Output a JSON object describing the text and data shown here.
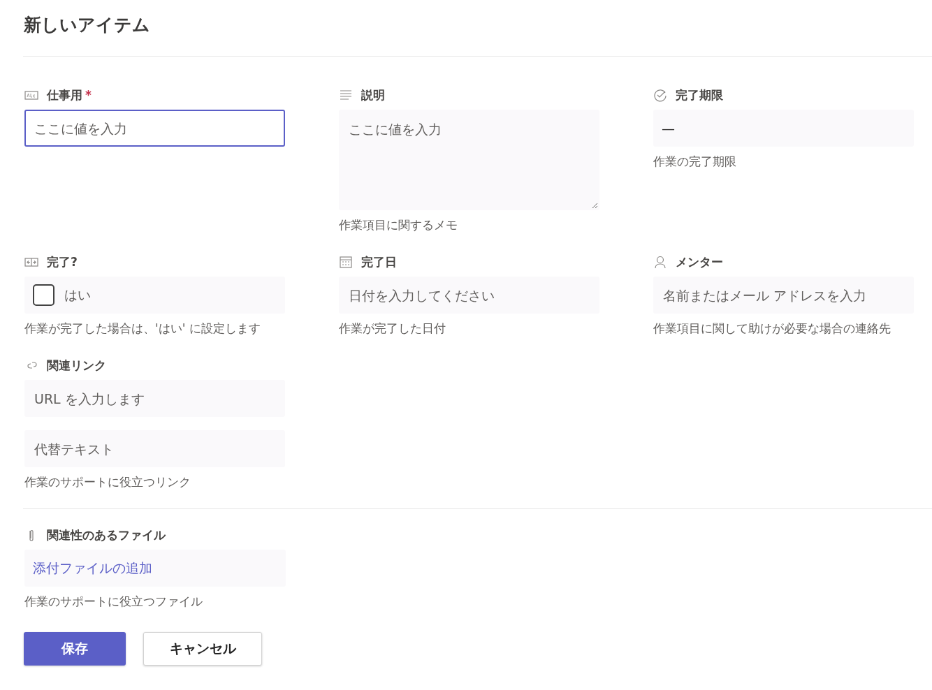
{
  "title": "新しいアイテム",
  "fields": [
    {
      "kind": "text",
      "label": "仕事用",
      "required_mark": "*",
      "focused": true,
      "placeholder": "ここに値を入力"
    },
    {
      "kind": "textarea",
      "label": "説明",
      "placeholder": "ここに値を入力",
      "hint": "作業項目に関するメモ"
    },
    {
      "kind": "readonly",
      "label": "完了期限",
      "value": "—",
      "hint": "作業の完了期限"
    },
    {
      "kind": "checkbox",
      "label": "完了?",
      "option": "はい",
      "checked": false,
      "hint": "作業が完了した場合は、'はい' に設定します"
    },
    {
      "kind": "date",
      "label": "完了日",
      "placeholder": "日付を入力してください",
      "hint": "作業が完了した日付"
    },
    {
      "kind": "person",
      "label": "メンター",
      "placeholder": "名前またはメール アドレスを入力",
      "hint": "作業項目に関して助けが必要な場合の連絡先"
    },
    {
      "kind": "link",
      "label": "関連リンク",
      "placeholder": "URL を入力します",
      "alt_placeholder": "代替テキスト",
      "hint": "作業のサポートに役立つリンク"
    }
  ],
  "attachments": {
    "label": "関連性のあるファイル",
    "link": "添付ファイルの追加",
    "hint": "作業のサポートに役立つファイル"
  },
  "buttons": [
    {
      "kind": "primary",
      "label": "保存"
    },
    {
      "kind": "secondary",
      "label": "キャンセル"
    }
  ]
}
